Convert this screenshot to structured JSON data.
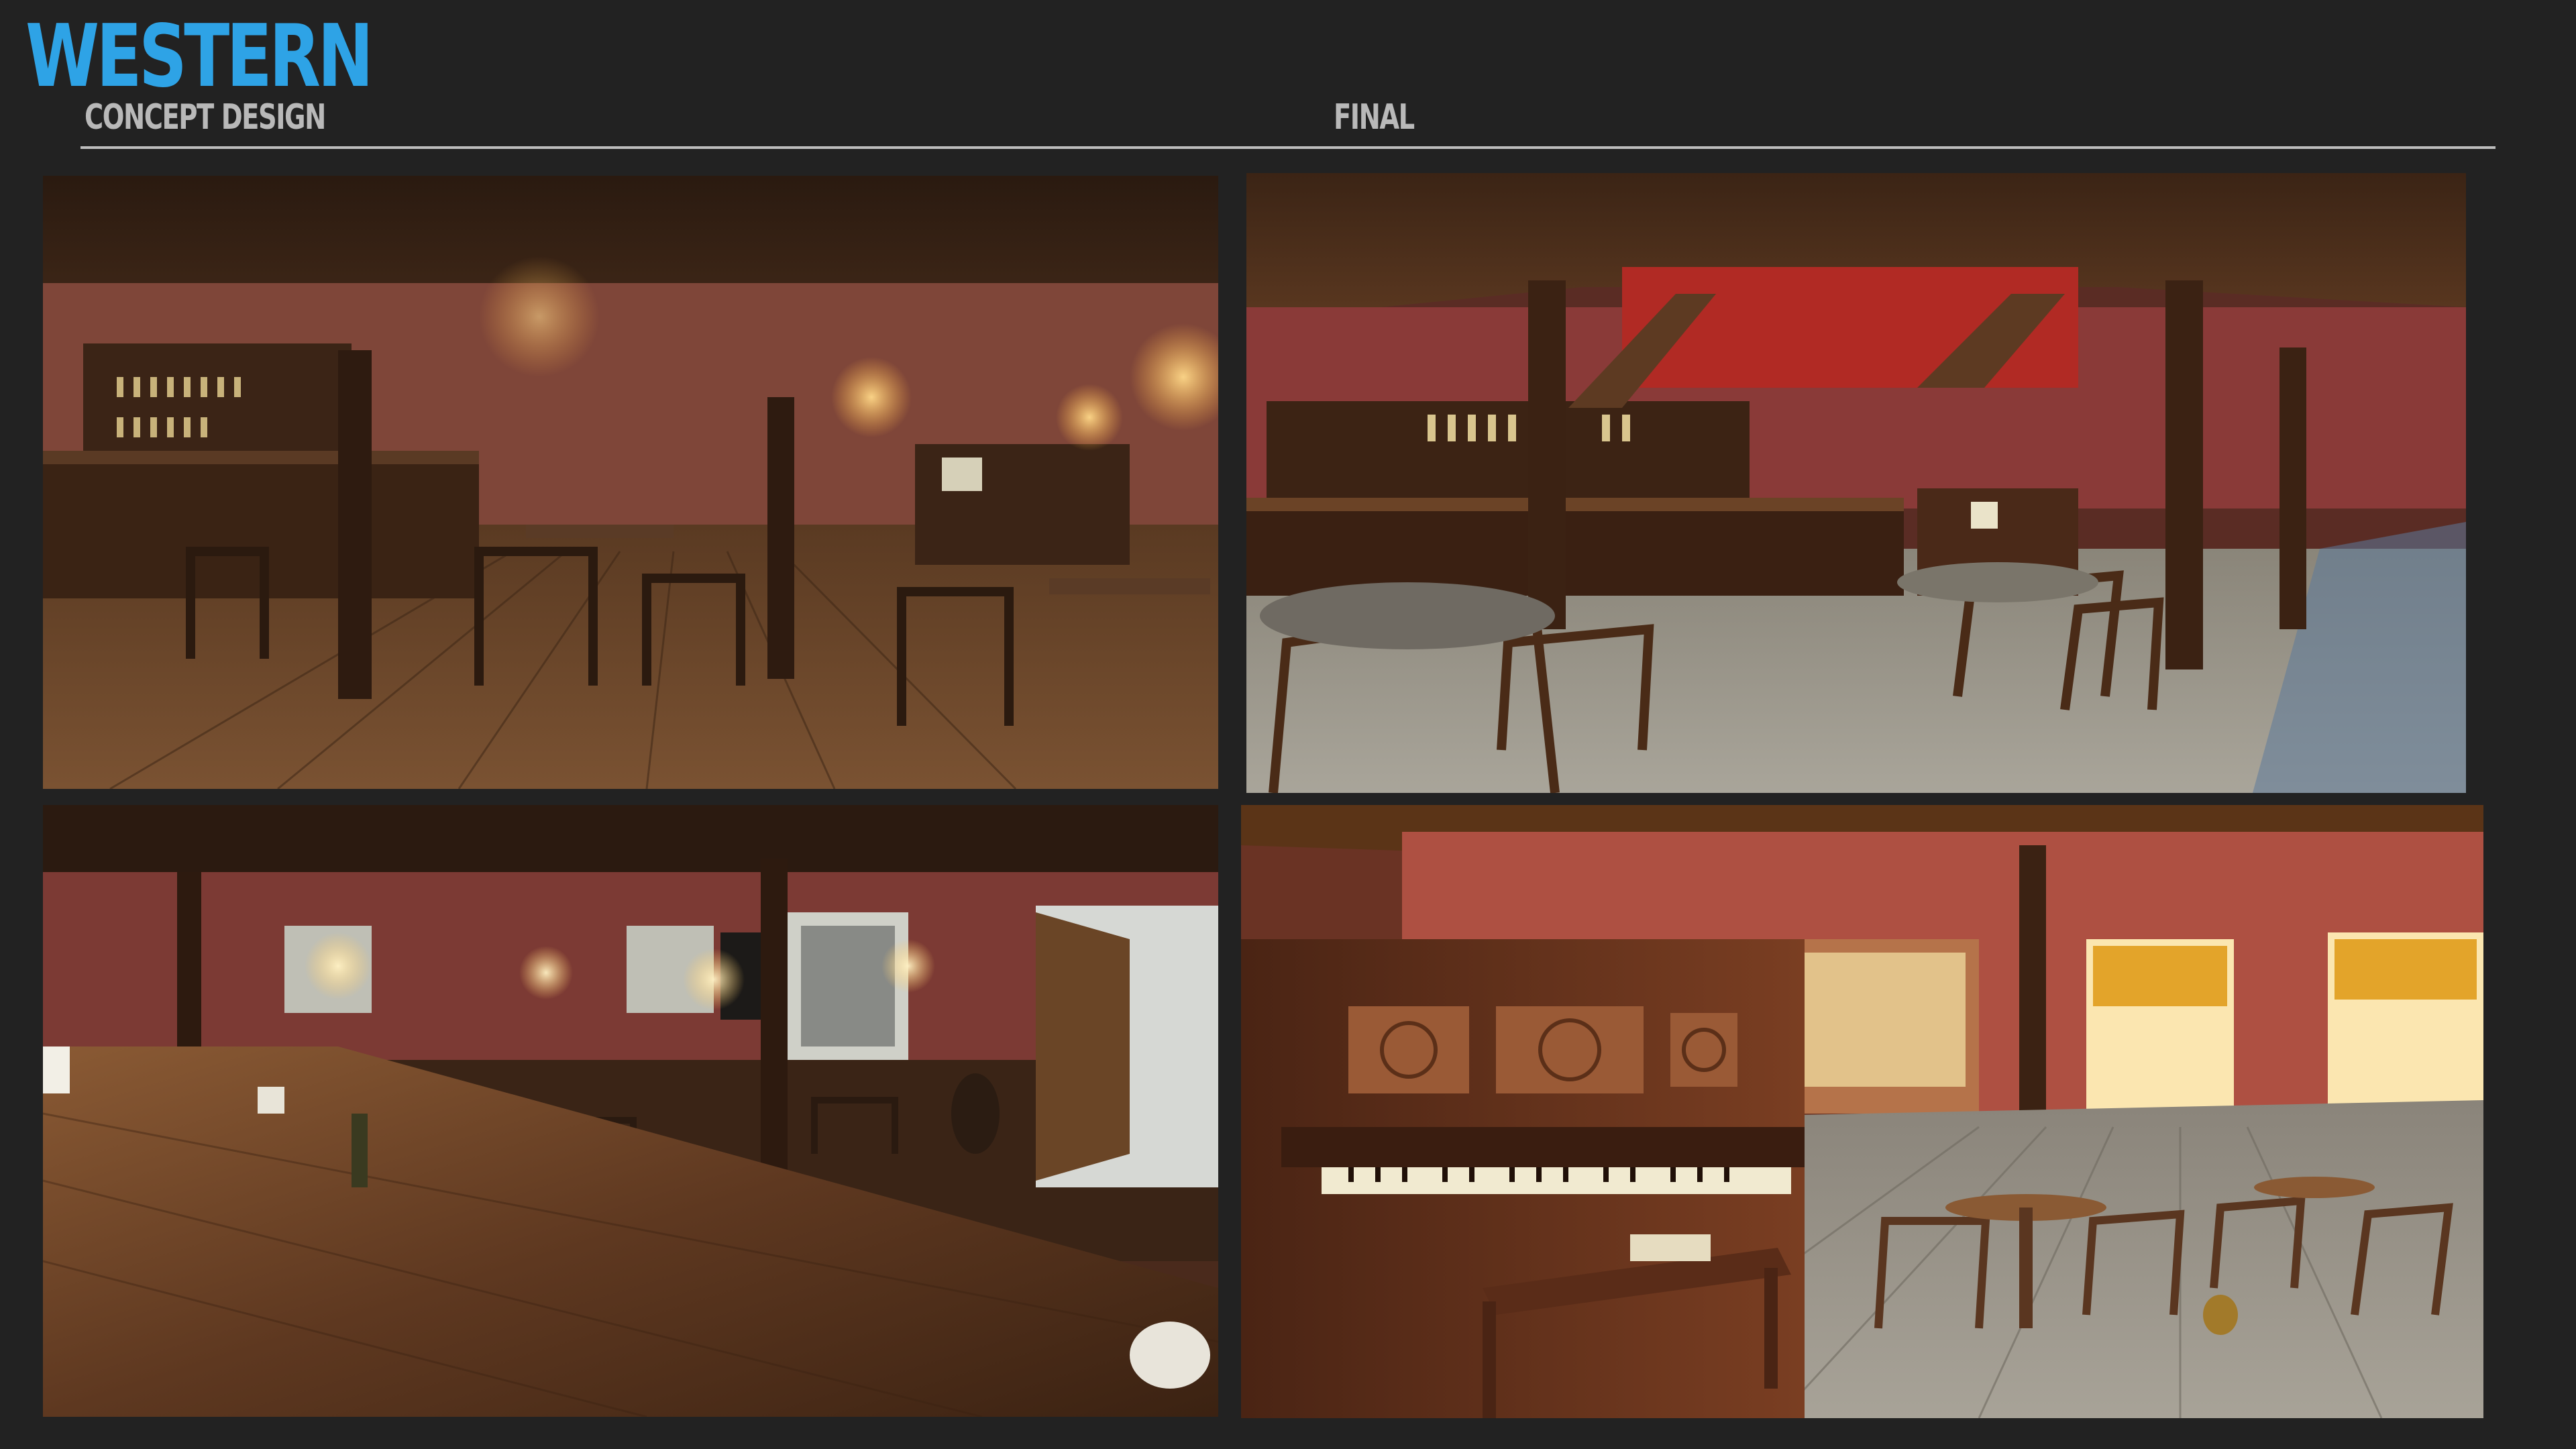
{
  "header": {
    "title": "WESTERN",
    "concept_label": "CONCEPT DESIGN",
    "final_label": "FINAL"
  },
  "colors": {
    "background": "#222222",
    "title_accent": "#2ea3e6",
    "label_text": "#b9b9b9",
    "divider": "#bdbdbd"
  },
  "panels": [
    {
      "id": "concept-saloon-bar",
      "column": "concept",
      "row": 1
    },
    {
      "id": "final-saloon-bar",
      "column": "final",
      "row": 1
    },
    {
      "id": "concept-saloon-counter",
      "column": "concept",
      "row": 2
    },
    {
      "id": "final-saloon-piano",
      "column": "final",
      "row": 2
    }
  ]
}
